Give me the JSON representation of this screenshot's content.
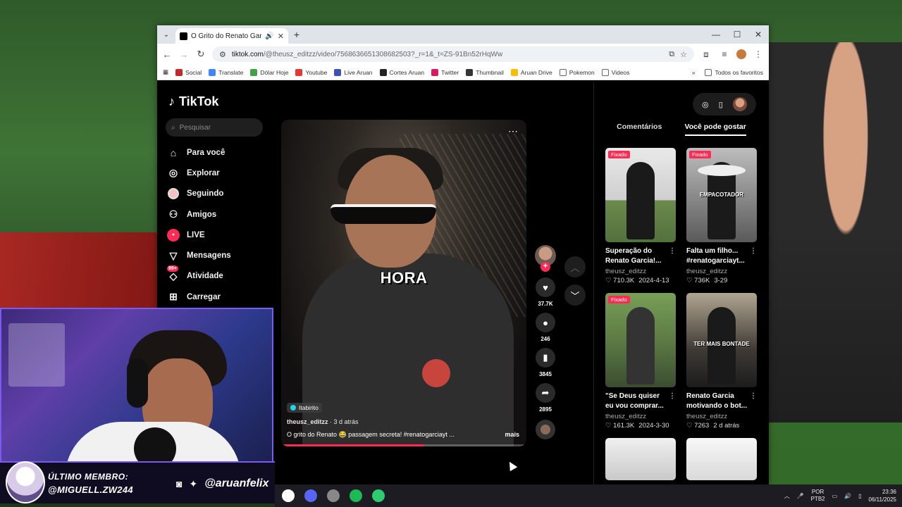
{
  "browser": {
    "tab_title": "O Grito do Renato Garcia e",
    "url_domain": "tiktok.com",
    "url_path": "/@theusz_editzz/video/7568636651308682503?_r=1&_t=ZS-91Bn52rHqWw",
    "bookmarks": [
      "Social",
      "Translate",
      "Dólar Hoje",
      "Youtube",
      "Live Aruan",
      "Cortes Aruan",
      "Twitter",
      "Thumbnail",
      "Aruan Drive",
      "Pokemon",
      "Videos"
    ],
    "bookmarks_more": "»",
    "all_bookmarks": "Todos os favoritos"
  },
  "tiktok": {
    "logo": "TikTok",
    "search_placeholder": "Pesquisar",
    "nav": [
      {
        "label": "Para você",
        "icon": "home-icon"
      },
      {
        "label": "Explorar",
        "icon": "compass-icon"
      },
      {
        "label": "Seguindo",
        "icon": "following-icon"
      },
      {
        "label": "Amigos",
        "icon": "friends-icon"
      },
      {
        "label": "LIVE",
        "icon": "live-icon"
      },
      {
        "label": "Mensagens",
        "icon": "send-icon"
      },
      {
        "label": "Atividade",
        "icon": "bell-icon",
        "badge": "99+"
      },
      {
        "label": "Carregar",
        "icon": "upload-icon"
      }
    ],
    "video": {
      "caption_overlay": "HORA",
      "location": "Itabirito",
      "author": "theusz_editzz",
      "age": "3 d atrás",
      "description": "O grito do Renato 😂 passagem secreta! #renatogarciayt ...",
      "more_label": "mais",
      "progress": 0.58,
      "likes": "37.7K",
      "comments": "246",
      "saves": "3845",
      "shares": "2895"
    },
    "right_tabs": {
      "comments": "Comentários",
      "suggested": "Você pode gostar"
    },
    "pinned_label": "Fixado",
    "cards": [
      {
        "title": "Superação do Renato Garcia!...",
        "user": "theusz_editzz",
        "likes": "710.3K",
        "date": "2024-4-13",
        "pinned": true,
        "thumb": "t1",
        "overlay": ""
      },
      {
        "title": "Falta um filho... #renatogarciayt...",
        "user": "theusz_editzz",
        "likes": "736K",
        "date": "3-29",
        "pinned": true,
        "thumb": "t2",
        "overlay": "EMPACOTADOR"
      },
      {
        "title": "\"Se Deus quiser eu vou comprar...",
        "user": "theusz_editzz",
        "likes": "161.3K",
        "date": "2024-3-30",
        "pinned": true,
        "thumb": "t3",
        "overlay": ""
      },
      {
        "title": "Renato Garcia motivando o bot...",
        "user": "theusz_editzz",
        "likes": "7263",
        "date": "2 d atrás",
        "pinned": false,
        "thumb": "t4",
        "overlay": "TER MAIS BONTADE"
      }
    ]
  },
  "stream": {
    "member_label": "ÚLTIMO MEMBRO:",
    "member_name": "@MIGUELL.ZW244",
    "handle": "@aruanfelix"
  },
  "taskbar": {
    "lang_top": "POR",
    "lang_bottom": "PTB2",
    "time": "23:36",
    "date": "06/11/2025"
  },
  "colors": {
    "accent": "#fe2c55",
    "cam_border": "#7a5af0"
  }
}
